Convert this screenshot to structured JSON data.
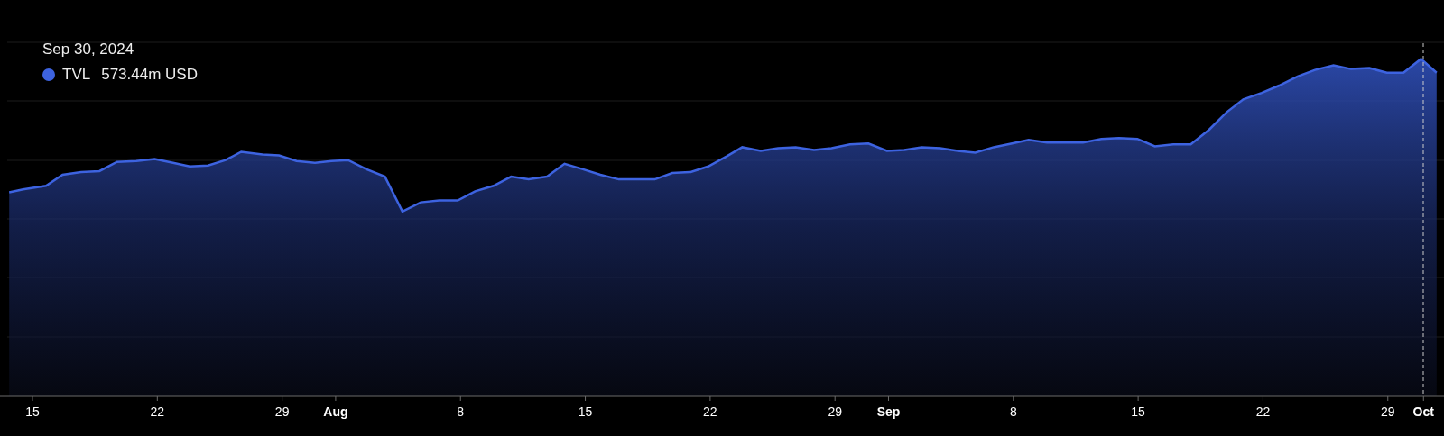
{
  "tooltip": {
    "date": "Sep 30, 2024",
    "series": "TVL",
    "value": "573.44m USD"
  },
  "x_axis": {
    "ticks": [
      {
        "label": "15",
        "kind": "day"
      },
      {
        "label": "22",
        "kind": "day"
      },
      {
        "label": "29",
        "kind": "day"
      },
      {
        "label": "Aug",
        "kind": "month"
      },
      {
        "label": "8",
        "kind": "day"
      },
      {
        "label": "15",
        "kind": "day"
      },
      {
        "label": "22",
        "kind": "day"
      },
      {
        "label": "29",
        "kind": "day"
      },
      {
        "label": "Sep",
        "kind": "month"
      },
      {
        "label": "8",
        "kind": "day"
      },
      {
        "label": "15",
        "kind": "day"
      },
      {
        "label": "22",
        "kind": "day"
      },
      {
        "label": "29",
        "kind": "day"
      },
      {
        "label": "Oct",
        "kind": "month"
      }
    ]
  }
}
